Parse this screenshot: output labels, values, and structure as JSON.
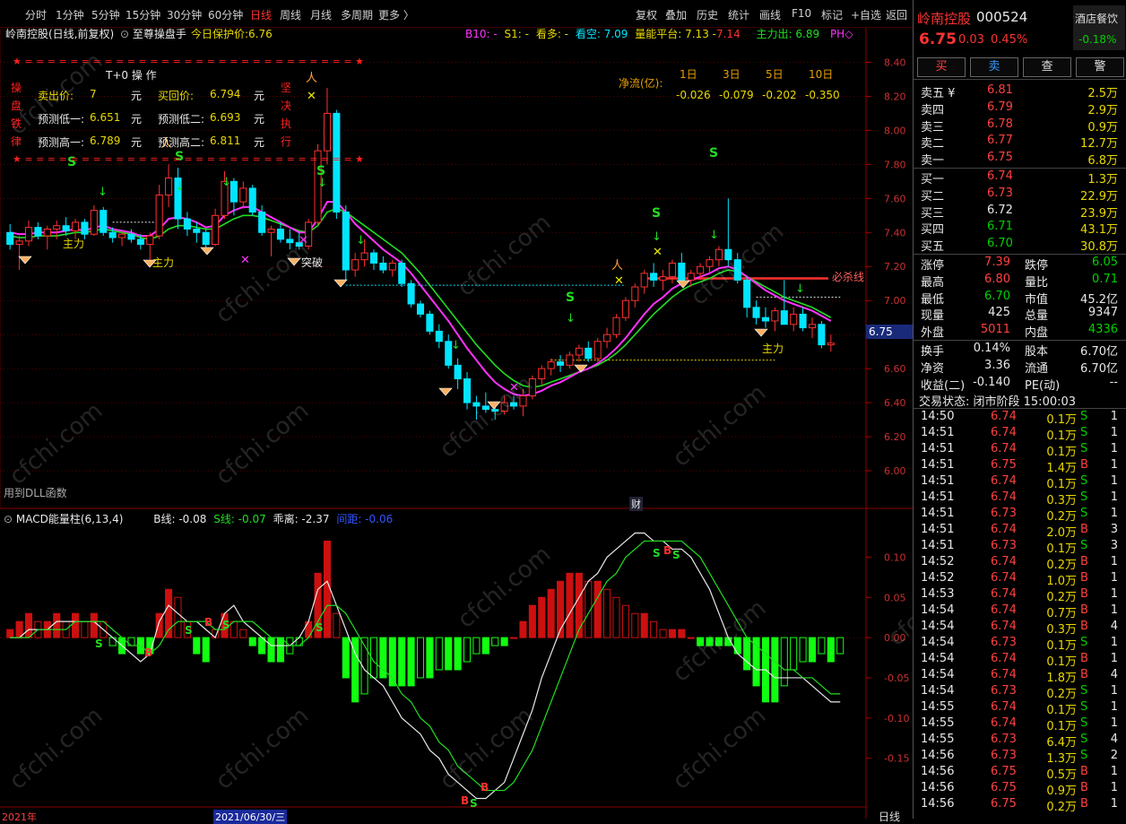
{
  "toolbar": {
    "periods": [
      "分时",
      "1分钟",
      "5分钟",
      "15分钟",
      "30分钟",
      "60分钟",
      "日线",
      "周线",
      "月线",
      "多周期",
      "更多 〉"
    ],
    "active_index": 6,
    "tools": [
      "复权",
      "叠加",
      "历史",
      "统计",
      "画线",
      "F10",
      "标记",
      "+自选",
      "返回"
    ]
  },
  "chart_header": {
    "stock": "岭南控股(日线,前复权)",
    "indicator": "至尊操盘手",
    "protect_label": "今日保护价:",
    "protect_value": "6.76",
    "b10_label": "B10: -",
    "s1_label": "S1: -",
    "bull_label": "看多: -",
    "bear_label": "看空: 7.09",
    "platform_label": "量能平台: 7.13 -",
    "platform_value": "7.14",
    "main_label": "主力出: 6.89",
    "ph_label": "PH◇"
  },
  "t0_box": {
    "stars": "★ = = = = = = = = = = = = = = = = = = = = = = = = = = = = = ★",
    "title": "T+0 操 作",
    "left_side": [
      "操",
      "盘",
      "铁",
      "律"
    ],
    "right_side": [
      "坚",
      "决",
      "执",
      "行"
    ],
    "rows": [
      {
        "l_label": "卖出价:",
        "l_val": "7",
        "l_unit": "元",
        "r_label": "买回价:",
        "r_val": "6.794",
        "r_unit": "元"
      },
      {
        "l_label": "预测低一:",
        "l_val": "6.651",
        "l_unit": "元",
        "r_label": "预测低二:",
        "r_val": "6.693",
        "r_unit": "元"
      },
      {
        "l_label": "预测高一:",
        "l_val": "6.789",
        "l_unit": "元",
        "r_label": "预测高二:",
        "r_val": "6.811",
        "r_unit": "元"
      }
    ]
  },
  "net_flow": {
    "label": "净流(亿):",
    "periods": [
      "1日",
      "3日",
      "5日",
      "10日"
    ],
    "values": [
      "-0.026",
      "-0.079",
      "-0.202",
      "-0.350"
    ]
  },
  "chart_labels": {
    "main_force": "主力",
    "breakthrough": "突破",
    "must_kill": "必杀线",
    "dll_note": "用到DLL函数",
    "cai": "财",
    "current_price_tag": "6.75"
  },
  "price_axis": [
    "8.40",
    "8.20",
    "8.00",
    "7.80",
    "7.60",
    "7.40",
    "7.20",
    "7.00",
    "6.80",
    "6.60",
    "6.40",
    "6.20",
    "6.00"
  ],
  "macd_header": {
    "name": "MACD能量柱(6,13,4)",
    "b_label": "B线: -0.08",
    "s_label": "S线: -0.07",
    "diverge_label": "乖离: -2.37",
    "gap_label": "间距: -0.06"
  },
  "macd_axis": [
    "0.10",
    "0.05",
    "0.00",
    "-0.05",
    "-0.10",
    "-0.15"
  ],
  "date_axis": {
    "year": "2021年",
    "date": "2021/06/30/三",
    "period": "日线"
  },
  "colors": {
    "up": "#ff3030",
    "down": "#00e5ff",
    "ma_fast": "#ff33ff",
    "ma_slow": "#22dd22",
    "bg": "#000000",
    "grid": "#5a0000"
  },
  "chart_data": {
    "type": "candlestick",
    "ylim": [
      6.0,
      8.45
    ],
    "ohlc": [
      [
        7.4,
        7.45,
        7.3,
        7.33
      ],
      [
        7.33,
        7.38,
        7.18,
        7.35
      ],
      [
        7.35,
        7.47,
        7.32,
        7.43
      ],
      [
        7.43,
        7.46,
        7.36,
        7.38
      ],
      [
        7.38,
        7.44,
        7.3,
        7.42
      ],
      [
        7.42,
        7.47,
        7.36,
        7.44
      ],
      [
        7.44,
        7.49,
        7.38,
        7.41
      ],
      [
        7.41,
        7.48,
        7.36,
        7.46
      ],
      [
        7.46,
        7.48,
        7.36,
        7.39
      ],
      [
        7.39,
        7.56,
        7.38,
        7.53
      ],
      [
        7.53,
        7.55,
        7.38,
        7.4
      ],
      [
        7.4,
        7.43,
        7.34,
        7.37
      ],
      [
        7.37,
        7.41,
        7.32,
        7.39
      ],
      [
        7.39,
        7.42,
        7.34,
        7.36
      ],
      [
        7.36,
        7.39,
        7.3,
        7.33
      ],
      [
        7.33,
        7.4,
        7.24,
        7.38
      ],
      [
        7.38,
        7.68,
        7.36,
        7.62
      ],
      [
        7.62,
        7.8,
        7.55,
        7.72
      ],
      [
        7.72,
        7.78,
        7.42,
        7.48
      ],
      [
        7.48,
        7.52,
        7.38,
        7.42
      ],
      [
        7.42,
        7.46,
        7.34,
        7.4
      ],
      [
        7.4,
        7.42,
        7.3,
        7.33
      ],
      [
        7.33,
        7.54,
        7.32,
        7.5
      ],
      [
        7.5,
        7.76,
        7.48,
        7.7
      ],
      [
        7.7,
        7.72,
        7.5,
        7.58
      ],
      [
        7.58,
        7.7,
        7.54,
        7.66
      ],
      [
        7.66,
        7.68,
        7.5,
        7.52
      ],
      [
        7.52,
        7.56,
        7.38,
        7.4
      ],
      [
        7.4,
        7.44,
        7.26,
        7.42
      ],
      [
        7.42,
        7.46,
        7.34,
        7.36
      ],
      [
        7.36,
        7.42,
        7.3,
        7.34
      ],
      [
        7.34,
        7.4,
        7.3,
        7.32
      ],
      [
        7.32,
        7.48,
        7.3,
        7.46
      ],
      [
        7.46,
        7.92,
        7.44,
        7.88
      ],
      [
        7.88,
        8.25,
        7.8,
        8.1
      ],
      [
        8.1,
        8.12,
        7.48,
        7.52
      ],
      [
        7.52,
        7.56,
        7.12,
        7.18
      ],
      [
        7.18,
        7.28,
        7.14,
        7.24
      ],
      [
        7.24,
        7.36,
        7.2,
        7.28
      ],
      [
        7.28,
        7.3,
        7.18,
        7.22
      ],
      [
        7.22,
        7.26,
        7.16,
        7.18
      ],
      [
        7.18,
        7.24,
        7.14,
        7.22
      ],
      [
        7.22,
        7.24,
        7.08,
        7.1
      ],
      [
        7.1,
        7.12,
        6.96,
        6.98
      ],
      [
        6.98,
        7.0,
        6.9,
        6.92
      ],
      [
        6.92,
        6.94,
        6.8,
        6.82
      ],
      [
        6.82,
        6.86,
        6.72,
        6.76
      ],
      [
        6.76,
        6.8,
        6.6,
        6.62
      ],
      [
        6.62,
        6.66,
        6.48,
        6.54
      ],
      [
        6.54,
        6.58,
        6.36,
        6.4
      ],
      [
        6.4,
        6.44,
        6.3,
        6.38
      ],
      [
        6.38,
        6.46,
        6.34,
        6.36
      ],
      [
        6.36,
        6.4,
        6.3,
        6.35
      ],
      [
        6.35,
        6.44,
        6.33,
        6.4
      ],
      [
        6.4,
        6.44,
        6.36,
        6.38
      ],
      [
        6.38,
        6.48,
        6.32,
        6.44
      ],
      [
        6.44,
        6.56,
        6.42,
        6.54
      ],
      [
        6.54,
        6.62,
        6.5,
        6.6
      ],
      [
        6.6,
        6.66,
        6.56,
        6.64
      ],
      [
        6.64,
        6.68,
        6.58,
        6.62
      ],
      [
        6.62,
        6.7,
        6.6,
        6.68
      ],
      [
        6.68,
        6.74,
        6.64,
        6.72
      ],
      [
        6.72,
        6.76,
        6.64,
        6.66
      ],
      [
        6.66,
        6.78,
        6.64,
        6.76
      ],
      [
        6.76,
        6.84,
        6.72,
        6.8
      ],
      [
        6.8,
        6.92,
        6.78,
        6.9
      ],
      [
        6.9,
        7.02,
        6.88,
        7.0
      ],
      [
        7.0,
        7.1,
        6.96,
        7.08
      ],
      [
        7.08,
        7.18,
        7.04,
        7.16
      ],
      [
        7.16,
        7.22,
        7.08,
        7.12
      ],
      [
        7.12,
        7.18,
        7.06,
        7.14
      ],
      [
        7.14,
        7.24,
        7.1,
        7.22
      ],
      [
        7.22,
        7.28,
        7.1,
        7.12
      ],
      [
        7.12,
        7.18,
        7.08,
        7.16
      ],
      [
        7.16,
        7.22,
        7.12,
        7.2
      ],
      [
        7.2,
        7.26,
        7.16,
        7.24
      ],
      [
        7.24,
        7.32,
        7.2,
        7.3
      ],
      [
        7.3,
        7.6,
        7.2,
        7.24
      ],
      [
        7.24,
        7.28,
        7.1,
        7.12
      ],
      [
        7.12,
        7.14,
        6.9,
        6.96
      ],
      [
        6.96,
        7.0,
        6.86,
        6.9
      ],
      [
        6.9,
        6.96,
        6.84,
        6.88
      ],
      [
        6.88,
        6.96,
        6.82,
        6.94
      ],
      [
        6.94,
        7.12,
        6.9,
        6.86
      ],
      [
        6.86,
        6.96,
        6.82,
        6.92
      ],
      [
        6.92,
        6.96,
        6.82,
        6.84
      ],
      [
        6.84,
        6.9,
        6.78,
        6.86
      ],
      [
        6.86,
        6.88,
        6.72,
        6.74
      ],
      [
        6.74,
        6.8,
        6.7,
        6.75
      ]
    ],
    "ma_fast": [
      7.4,
      7.39,
      7.39,
      7.4,
      7.4,
      7.4,
      7.41,
      7.42,
      7.41,
      7.43,
      7.44,
      7.42,
      7.41,
      7.4,
      7.38,
      7.38,
      7.42,
      7.48,
      7.49,
      7.48,
      7.46,
      7.43,
      7.44,
      7.5,
      7.53,
      7.55,
      7.55,
      7.52,
      7.49,
      7.46,
      7.43,
      7.4,
      7.4,
      7.48,
      7.58,
      7.58,
      7.52,
      7.45,
      7.4,
      7.35,
      7.3,
      7.26,
      7.22,
      7.16,
      7.09,
      7.02,
      6.95,
      6.88,
      6.8,
      6.72,
      6.65,
      6.58,
      6.52,
      6.48,
      6.45,
      6.44,
      6.45,
      6.47,
      6.5,
      6.52,
      6.55,
      6.58,
      6.6,
      6.63,
      6.67,
      6.72,
      6.78,
      6.85,
      6.92,
      6.98,
      7.02,
      7.07,
      7.1,
      7.12,
      7.14,
      7.16,
      7.19,
      7.2,
      7.18,
      7.14,
      7.1,
      7.06,
      7.03,
      7.0,
      6.98,
      6.96,
      6.94,
      6.91,
      6.88
    ],
    "ma_slow": [
      7.38,
      7.37,
      7.37,
      7.38,
      7.38,
      7.38,
      7.39,
      7.4,
      7.4,
      7.41,
      7.42,
      7.41,
      7.4,
      7.39,
      7.37,
      7.36,
      7.38,
      7.42,
      7.44,
      7.44,
      7.43,
      7.42,
      7.42,
      7.45,
      7.48,
      7.5,
      7.5,
      7.49,
      7.47,
      7.45,
      7.43,
      7.41,
      7.4,
      7.44,
      7.52,
      7.54,
      7.52,
      7.48,
      7.44,
      7.4,
      7.36,
      7.32,
      7.28,
      7.22,
      7.16,
      7.09,
      7.02,
      6.95,
      6.88,
      6.81,
      6.74,
      6.68,
      6.62,
      6.57,
      6.53,
      6.5,
      6.49,
      6.5,
      6.52,
      6.54,
      6.56,
      6.58,
      6.6,
      6.62,
      6.65,
      6.69,
      6.74,
      6.8,
      6.86,
      6.92,
      6.97,
      7.02,
      7.06,
      7.09,
      7.11,
      7.13,
      7.16,
      7.18,
      7.17,
      7.14,
      7.11,
      7.08,
      7.05,
      7.02,
      7.0,
      6.98,
      6.96,
      6.93,
      6.9
    ],
    "macd_bars": [
      0.01,
      0.02,
      0.03,
      0.02,
      0.02,
      0.03,
      0.02,
      0.03,
      0.02,
      0.03,
      0.02,
      -0.01,
      -0.02,
      -0.01,
      -0.02,
      -0.02,
      0.03,
      0.06,
      0.05,
      0.02,
      -0.02,
      -0.03,
      0.01,
      0.03,
      0.02,
      0.01,
      -0.01,
      -0.02,
      -0.03,
      -0.03,
      -0.02,
      -0.01,
      0.02,
      0.08,
      0.12,
      0.03,
      -0.05,
      -0.08,
      -0.07,
      -0.05,
      -0.05,
      -0.06,
      -0.06,
      -0.06,
      -0.05,
      -0.05,
      -0.04,
      -0.04,
      -0.04,
      -0.03,
      -0.02,
      -0.02,
      -0.01,
      -0.01,
      0.0,
      0.02,
      0.04,
      0.05,
      0.06,
      0.07,
      0.08,
      0.08,
      0.07,
      0.07,
      0.06,
      0.05,
      0.04,
      0.03,
      0.03,
      0.02,
      0.01,
      0.01,
      0.01,
      0.0,
      -0.01,
      -0.01,
      -0.01,
      -0.01,
      -0.02,
      -0.04,
      -0.06,
      -0.08,
      -0.08,
      -0.06,
      -0.04,
      -0.03,
      -0.03,
      -0.02,
      -0.03,
      -0.02
    ],
    "b_line": [
      0.0,
      0.0,
      0.01,
      0.01,
      0.01,
      0.02,
      0.02,
      0.02,
      0.02,
      0.02,
      0.01,
      0.0,
      -0.01,
      -0.02,
      -0.03,
      -0.02,
      0.02,
      0.04,
      0.03,
      0.02,
      0.02,
      0.01,
      0.0,
      0.03,
      0.04,
      0.02,
      0.01,
      0.0,
      -0.01,
      -0.01,
      -0.01,
      0.0,
      0.02,
      0.06,
      0.07,
      0.04,
      0.01,
      -0.02,
      -0.04,
      -0.05,
      -0.06,
      -0.08,
      -0.1,
      -0.11,
      -0.12,
      -0.14,
      -0.15,
      -0.17,
      -0.18,
      -0.19,
      -0.2,
      -0.2,
      -0.19,
      -0.18,
      -0.15,
      -0.12,
      -0.09,
      -0.05,
      -0.02,
      0.01,
      0.03,
      0.05,
      0.07,
      0.08,
      0.1,
      0.11,
      0.12,
      0.13,
      0.13,
      0.12,
      0.12,
      0.11,
      0.11,
      0.1,
      0.08,
      0.06,
      0.03,
      0.0,
      -0.02,
      -0.03,
      -0.04,
      -0.04,
      -0.05,
      -0.05,
      -0.05,
      -0.05,
      -0.06,
      -0.07,
      -0.08,
      -0.08
    ],
    "s_line": [
      0.0,
      0.0,
      0.0,
      0.01,
      0.01,
      0.01,
      0.01,
      0.02,
      0.02,
      0.02,
      0.02,
      0.01,
      0.0,
      -0.01,
      -0.01,
      -0.02,
      -0.01,
      0.01,
      0.02,
      0.02,
      0.02,
      0.02,
      0.01,
      0.01,
      0.02,
      0.02,
      0.02,
      0.01,
      0.0,
      0.0,
      -0.01,
      -0.01,
      0.0,
      0.02,
      0.04,
      0.04,
      0.03,
      0.01,
      -0.01,
      -0.03,
      -0.04,
      -0.05,
      -0.07,
      -0.08,
      -0.1,
      -0.11,
      -0.13,
      -0.14,
      -0.16,
      -0.17,
      -0.18,
      -0.19,
      -0.19,
      -0.19,
      -0.18,
      -0.16,
      -0.14,
      -0.11,
      -0.08,
      -0.05,
      -0.02,
      0.01,
      0.03,
      0.05,
      0.07,
      0.08,
      0.1,
      0.11,
      0.12,
      0.12,
      0.12,
      0.12,
      0.12,
      0.11,
      0.1,
      0.08,
      0.06,
      0.04,
      0.02,
      0.0,
      -0.01,
      -0.02,
      -0.03,
      -0.04,
      -0.04,
      -0.05,
      -0.05,
      -0.06,
      -0.07,
      -0.07
    ]
  },
  "quote": {
    "name": "岭南控股",
    "code": "000524",
    "sector": "酒店餐饮",
    "sector_change": "-0.18%",
    "price": "6.75",
    "change": "0.03",
    "change_pct": "0.45%",
    "buttons": [
      "买",
      "卖",
      "查",
      "警"
    ],
    "asks": [
      {
        "label": "卖五 ¥",
        "price": "6.81",
        "vol": "2.5万",
        "color": "red"
      },
      {
        "label": "卖四",
        "price": "6.79",
        "vol": "2.9万",
        "color": "red"
      },
      {
        "label": "卖三",
        "price": "6.78",
        "vol": "0.9万",
        "color": "red"
      },
      {
        "label": "卖二",
        "price": "6.77",
        "vol": "12.7万",
        "color": "red"
      },
      {
        "label": "卖一",
        "price": "6.75",
        "vol": "6.8万",
        "color": "red"
      }
    ],
    "bids": [
      {
        "label": "买一",
        "price": "6.74",
        "vol": "1.3万",
        "color": "red"
      },
      {
        "label": "买二",
        "price": "6.73",
        "vol": "22.9万",
        "color": "red"
      },
      {
        "label": "买三",
        "price": "6.72",
        "vol": "23.9万",
        "color": "white"
      },
      {
        "label": "买四",
        "price": "6.71",
        "vol": "43.1万",
        "color": "green"
      },
      {
        "label": "买五",
        "price": "6.70",
        "vol": "30.8万",
        "color": "green"
      }
    ],
    "stats": [
      {
        "l1": "涨停",
        "v1": "7.39",
        "c1": "red",
        "l2": "跌停",
        "v2": "6.05",
        "c2": "green"
      },
      {
        "l1": "最高",
        "v1": "6.80",
        "c1": "red",
        "l2": "量比",
        "v2": "0.71",
        "c2": "green"
      },
      {
        "l1": "最低",
        "v1": "6.70",
        "c1": "green",
        "l2": "市值",
        "v2": "45.2亿",
        "c2": "white"
      },
      {
        "l1": "现量",
        "v1": "425",
        "c1": "white",
        "l2": "总量",
        "v2": "9347",
        "c2": "white"
      },
      {
        "l1": "外盘",
        "v1": "5011",
        "c1": "red",
        "l2": "内盘",
        "v2": "4336",
        "c2": "green"
      }
    ],
    "stats2": [
      {
        "l1": "换手",
        "v1": "0.14%",
        "l2": "股本",
        "v2": "6.70亿"
      },
      {
        "l1": "净资",
        "v1": "3.36",
        "l2": "流通",
        "v2": "6.70亿"
      },
      {
        "l1": "收益(二)",
        "v1": "-0.140",
        "l2": "PE(动)",
        "v2": "--"
      }
    ],
    "trade_status": "交易状态: 闭市阶段 15:00:03",
    "ticks": [
      [
        "14:50",
        "6.74",
        "0.1万",
        "S",
        "1"
      ],
      [
        "14:51",
        "6.74",
        "0.1万",
        "S",
        "1"
      ],
      [
        "14:51",
        "6.74",
        "0.1万",
        "S",
        "1"
      ],
      [
        "14:51",
        "6.75",
        "1.4万",
        "B",
        "1"
      ],
      [
        "14:51",
        "6.74",
        "0.1万",
        "S",
        "1"
      ],
      [
        "14:51",
        "6.74",
        "0.3万",
        "S",
        "1"
      ],
      [
        "14:51",
        "6.73",
        "0.2万",
        "S",
        "1"
      ],
      [
        "14:51",
        "6.74",
        "2.0万",
        "B",
        "3"
      ],
      [
        "14:51",
        "6.73",
        "0.1万",
        "S",
        "3"
      ],
      [
        "14:52",
        "6.74",
        "0.2万",
        "B",
        "1"
      ],
      [
        "14:52",
        "6.74",
        "1.0万",
        "B",
        "1"
      ],
      [
        "14:53",
        "6.74",
        "0.2万",
        "B",
        "1"
      ],
      [
        "14:54",
        "6.74",
        "0.7万",
        "B",
        "1"
      ],
      [
        "14:54",
        "6.74",
        "0.3万",
        "B",
        "4"
      ],
      [
        "14:54",
        "6.73",
        "0.1万",
        "S",
        "1"
      ],
      [
        "14:54",
        "6.74",
        "0.1万",
        "B",
        "1"
      ],
      [
        "14:54",
        "6.74",
        "1.8万",
        "B",
        "4"
      ],
      [
        "14:54",
        "6.73",
        "0.2万",
        "S",
        "1"
      ],
      [
        "14:55",
        "6.74",
        "0.1万",
        "S",
        "1"
      ],
      [
        "14:55",
        "6.74",
        "0.1万",
        "S",
        "1"
      ],
      [
        "14:55",
        "6.73",
        "6.4万",
        "S",
        "4"
      ],
      [
        "14:56",
        "6.73",
        "1.3万",
        "S",
        "2"
      ],
      [
        "14:56",
        "6.75",
        "0.5万",
        "B",
        "1"
      ],
      [
        "14:56",
        "6.75",
        "0.9万",
        "B",
        "1"
      ],
      [
        "14:56",
        "6.75",
        "0.2万",
        "B",
        "1"
      ]
    ]
  }
}
